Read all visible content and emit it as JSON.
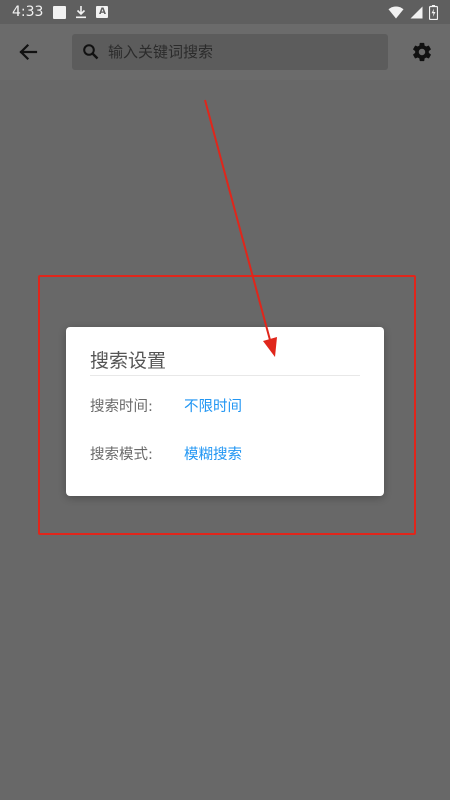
{
  "status_bar": {
    "time": "4:33",
    "a_glyph": "A",
    "icons": [
      "square-notification-icon",
      "download-icon",
      "a-notification-icon",
      "wifi-icon",
      "cellular-icon",
      "battery-icon"
    ]
  },
  "app_bar": {
    "search_placeholder": "输入关键词搜索",
    "icons": [
      "back-arrow-icon",
      "search-icon",
      "gear-icon"
    ]
  },
  "dialog": {
    "title": "搜索设置",
    "rows": [
      {
        "label": "搜索时间:",
        "value": "不限时间"
      },
      {
        "label": "搜索模式:",
        "value": "模糊搜索"
      }
    ]
  },
  "colors": {
    "scrim": "#686868",
    "accent": "#2196f3",
    "annotation": "#e0261b"
  }
}
